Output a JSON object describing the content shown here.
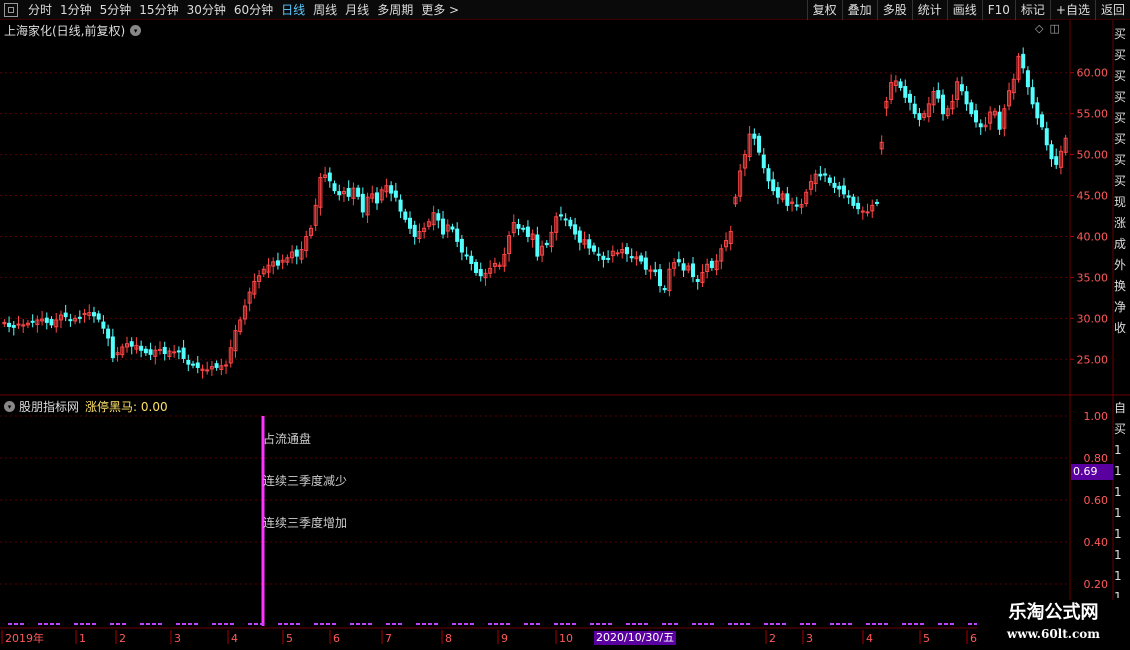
{
  "toolbar": {
    "periods": [
      "分时",
      "1分钟",
      "5分钟",
      "15分钟",
      "30分钟",
      "60分钟",
      "日线",
      "周线",
      "月线",
      "多周期",
      "更多 >"
    ],
    "active_period": "日线",
    "buttons": [
      "复权",
      "叠加",
      "多股",
      "统计",
      "画线",
      "F10",
      "标记",
      "+自选",
      "返回"
    ]
  },
  "chart_title": "上海家化(日线,前复权)",
  "price_axis": {
    "ticks": [
      "60.00",
      "55.00",
      "50.00",
      "45.00",
      "40.00",
      "35.00",
      "30.00",
      "25.00"
    ],
    "min": 21,
    "max": 64
  },
  "indicator": {
    "name": "股朋指标网",
    "value_label": "涨停黑马: 0.00",
    "ticks": [
      "1.00",
      "0.80",
      "0.60",
      "0.40",
      "0.20"
    ],
    "current_value": "0.69",
    "labels": [
      {
        "text": "占流通盘",
        "color": "#ffffff"
      },
      {
        "text": "连续三季度减少",
        "color": "#ff3c8c"
      },
      {
        "text": "连续三季度增加",
        "color": "#ffff66"
      }
    ]
  },
  "right_cut_chars": [
    "买",
    "买",
    "买",
    "买",
    "买",
    "买",
    "买",
    "买",
    "现",
    "涨",
    "成",
    "外",
    "换",
    "净",
    "收"
  ],
  "right_cut_chars_ind": [
    "自",
    "买",
    "1",
    "1",
    "1",
    "1",
    "1",
    "1",
    "1",
    "1",
    "1"
  ],
  "time_axis": {
    "labels": [
      "2019年",
      "1",
      "2",
      "3",
      "4",
      "5",
      "6",
      "7",
      "8",
      "9",
      "10",
      "2020/10/30/五",
      "12",
      "2",
      "3",
      "4",
      "5",
      "6"
    ]
  },
  "selected_date": "2020/10/30/五",
  "watermark": {
    "title": "乐淘公式网",
    "url": "www.60lt.com"
  },
  "colors": {
    "up": "#ff4646",
    "down": "#54ffff",
    "grid": "#5a0000",
    "accent": "#5a00a0"
  },
  "chart_data": {
    "type": "candlestick",
    "title": "上海家化(日线,前复权)",
    "ylim": [
      21,
      64
    ],
    "close_series": [
      29.5,
      29.0,
      28.9,
      29.3,
      29.2,
      29.4,
      29.6,
      29.8,
      29.9,
      29.5,
      29.2,
      29.8,
      30.4,
      30.2,
      29.8,
      30.0,
      30.1,
      30.6,
      30.7,
      30.3,
      29.9,
      28.8,
      27.6,
      25.2,
      25.8,
      26.5,
      26.9,
      26.6,
      26.7,
      26.1,
      25.8,
      25.6,
      26.1,
      26.2,
      25.7,
      26.0,
      25.9,
      26.0,
      25.1,
      24.4,
      24.3,
      24.0,
      23.8,
      23.7,
      24.1,
      24.0,
      24.2,
      24.3,
      26.4,
      28.5,
      29.8,
      31.5,
      33.2,
      34.5,
      35.2,
      36.0,
      36.5,
      36.9,
      36.5,
      37.1,
      37.4,
      38.1,
      37.6,
      38.4,
      40.0,
      41.0,
      43.8,
      47.2,
      47.5,
      46.8,
      45.6,
      45.1,
      45.5,
      44.9,
      45.9,
      44.9,
      43.0,
      44.8,
      45.2,
      44.1,
      45.7,
      46.2,
      45.3,
      44.8,
      43.1,
      42.1,
      41.0,
      40.0,
      40.6,
      41.0,
      41.8,
      42.9,
      42.0,
      40.3,
      41.4,
      40.9,
      39.4,
      38.1,
      37.7,
      36.7,
      35.6,
      35.2,
      35.5,
      36.1,
      36.7,
      36.5,
      37.8,
      40.1,
      41.7,
      41.0,
      40.9,
      40.0,
      40.3,
      37.6,
      38.8,
      39.0,
      40.5,
      42.4,
      42.5,
      42.1,
      41.3,
      40.3,
      39.3,
      39.6,
      38.6,
      38.2,
      37.7,
      37.2,
      37.3,
      38.2,
      38.0,
      38.4,
      37.9,
      37.4,
      37.5,
      37.0,
      36.0,
      35.9,
      35.7,
      34.0,
      33.5,
      36.0,
      36.8,
      36.9,
      35.9,
      36.4,
      35.1,
      34.5,
      35.6,
      36.6,
      36.2,
      37.0,
      38.5,
      39.5,
      40.6,
      44.8,
      48.0,
      50.0,
      52.5,
      52.0,
      50.3,
      48.4,
      46.8,
      45.6,
      44.8,
      45.2,
      43.8,
      44.2,
      43.7,
      43.9,
      45.4,
      46.7,
      47.6,
      47.4,
      47.5,
      46.6,
      46.0,
      45.8,
      45.2,
      44.8,
      43.8,
      43.4,
      43.1,
      43.0,
      43.8,
      44.1,
      51.5,
      56.5,
      58.8,
      59.0,
      58.2,
      57.0,
      56.4,
      55.0,
      54.3,
      55.0,
      56.2,
      57.7,
      56.9,
      55.0,
      55.6,
      56.5,
      58.9,
      57.8,
      56.2,
      55.0,
      54.0,
      53.4,
      53.6,
      55.2,
      55.3,
      53.1,
      55.6,
      57.8,
      59.2,
      62.0,
      60.6,
      58.3,
      56.2,
      54.5,
      53.4,
      51.2,
      49.5,
      48.8,
      50.4,
      52.0
    ]
  }
}
